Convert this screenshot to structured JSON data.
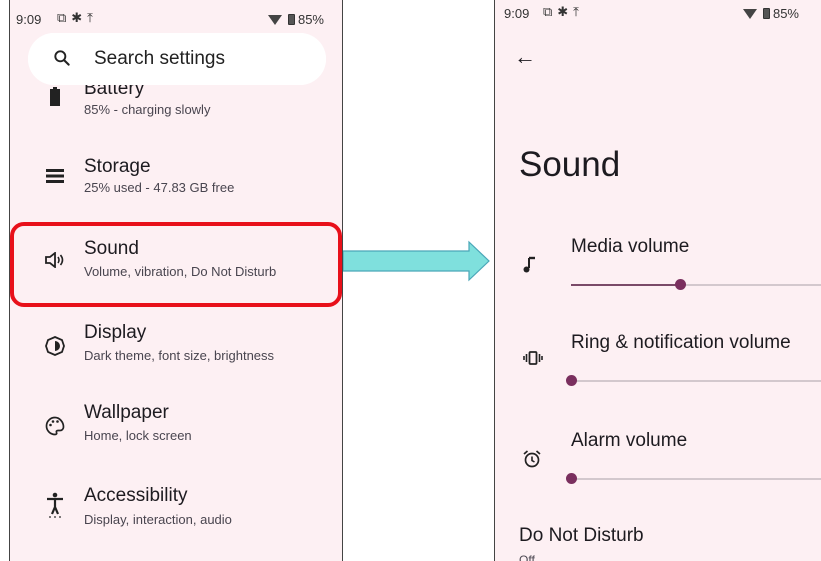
{
  "left": {
    "status": {
      "time": "9:09",
      "battery": "85%"
    },
    "search": {
      "placeholder": "Search settings"
    },
    "items": [
      {
        "title": "Battery",
        "subtitle": "85% - charging slowly",
        "icon": "battery-icon"
      },
      {
        "title": "Storage",
        "subtitle": "25% used - 47.83 GB free",
        "icon": "storage-icon"
      },
      {
        "title": "Sound",
        "subtitle": "Volume, vibration, Do Not Disturb",
        "icon": "sound-icon"
      },
      {
        "title": "Display",
        "subtitle": "Dark theme, font size, brightness",
        "icon": "display-icon"
      },
      {
        "title": "Wallpaper",
        "subtitle": "Home, lock screen",
        "icon": "wallpaper-icon"
      },
      {
        "title": "Accessibility",
        "subtitle": "Display, interaction, audio",
        "icon": "accessibility-icon"
      }
    ]
  },
  "right": {
    "status": {
      "time": "9:09",
      "battery": "85%"
    },
    "title": "Sound",
    "volumes": [
      {
        "label": "Media volume",
        "level": 0.42,
        "icon": "music-note-icon"
      },
      {
        "label": "Ring & notification volume",
        "level": 0.0,
        "icon": "vibrate-icon"
      },
      {
        "label": "Alarm volume",
        "level": 0.0,
        "icon": "alarm-icon"
      }
    ],
    "dnd": {
      "title": "Do Not Disturb",
      "subtitle": "Off"
    }
  },
  "colors": {
    "background": "#fdf0f3",
    "accent": "#7a2f5e",
    "highlight": "#e8101a",
    "arrow": "#7fe0dd"
  }
}
